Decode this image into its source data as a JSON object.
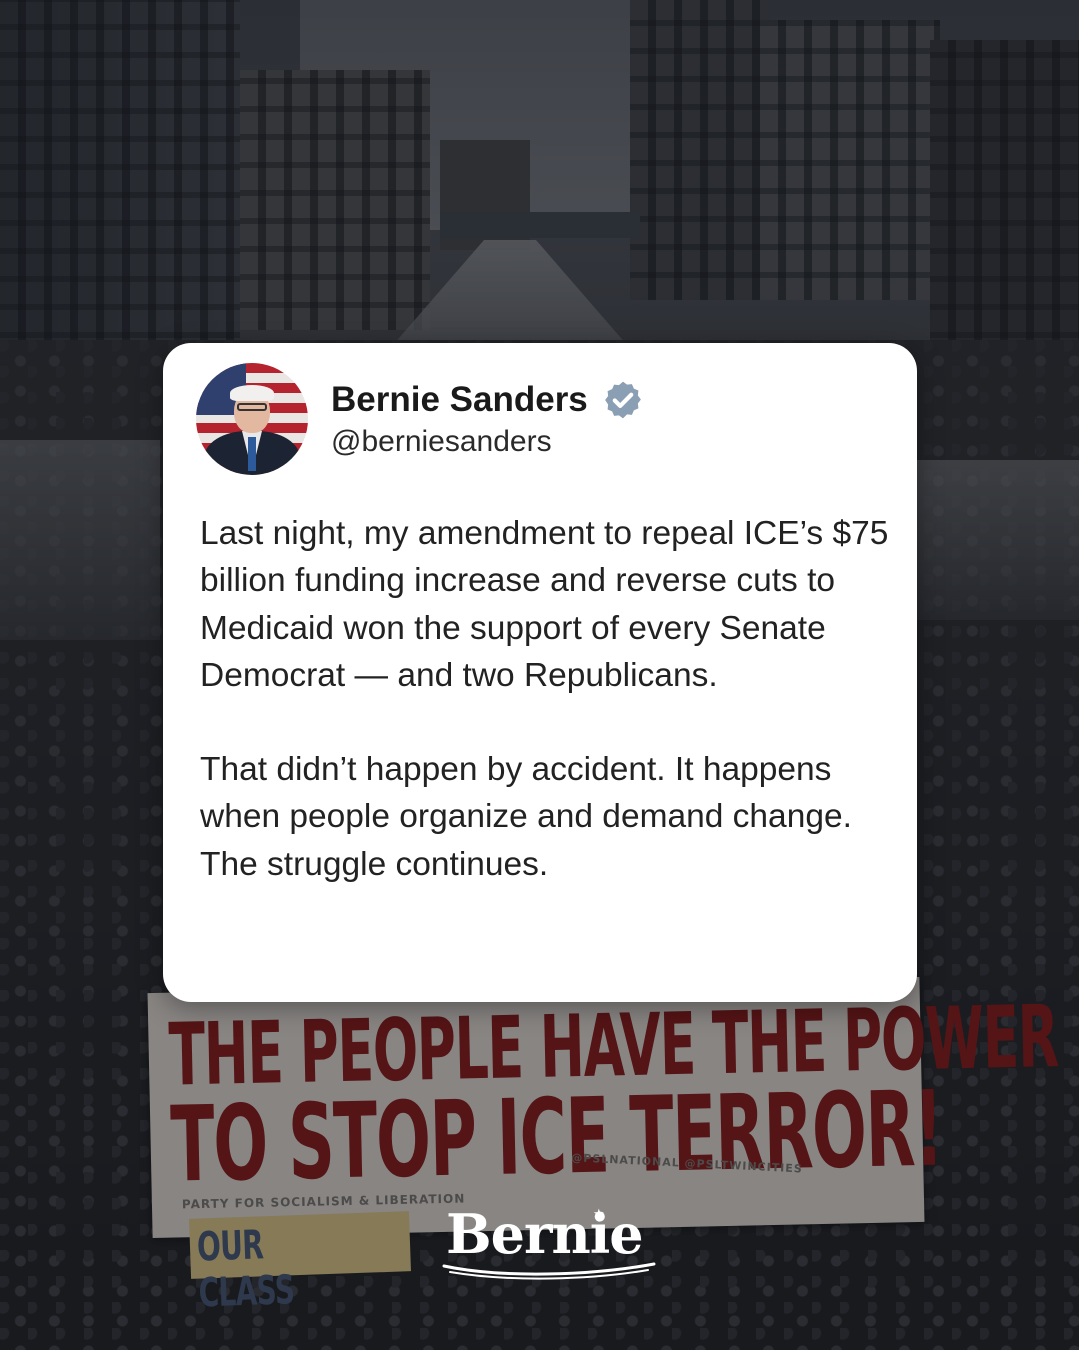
{
  "post": {
    "author_name": "Bernie Sanders",
    "handle": "@berniesanders",
    "verified": true,
    "paragraphs": [
      "Last night, my amendment to repeal ICE’s $75 billion funding increase and reverse cuts to Medicaid won the support of every Senate Democrat — and two Republicans.",
      "That didn’t happen by accident. It happens when people organize and demand change. The struggle continues."
    ]
  },
  "background": {
    "banner_line_1": "THE PEOPLE HAVE THE POWER",
    "banner_line_2": "TO STOP ICE TERROR!",
    "banner_footer": "PARTY FOR SOCIALISM & LIBERATION",
    "banner_footer_2": "@PSLNATIONAL @PSLTWINCITIES",
    "secondary_banner": "OUR CLASS"
  },
  "brand": {
    "logo_text": "Bernie"
  },
  "colors": {
    "card_background": "#ffffff",
    "verified_badge": "#8a9fb4",
    "banner_text": "#7b1616"
  }
}
